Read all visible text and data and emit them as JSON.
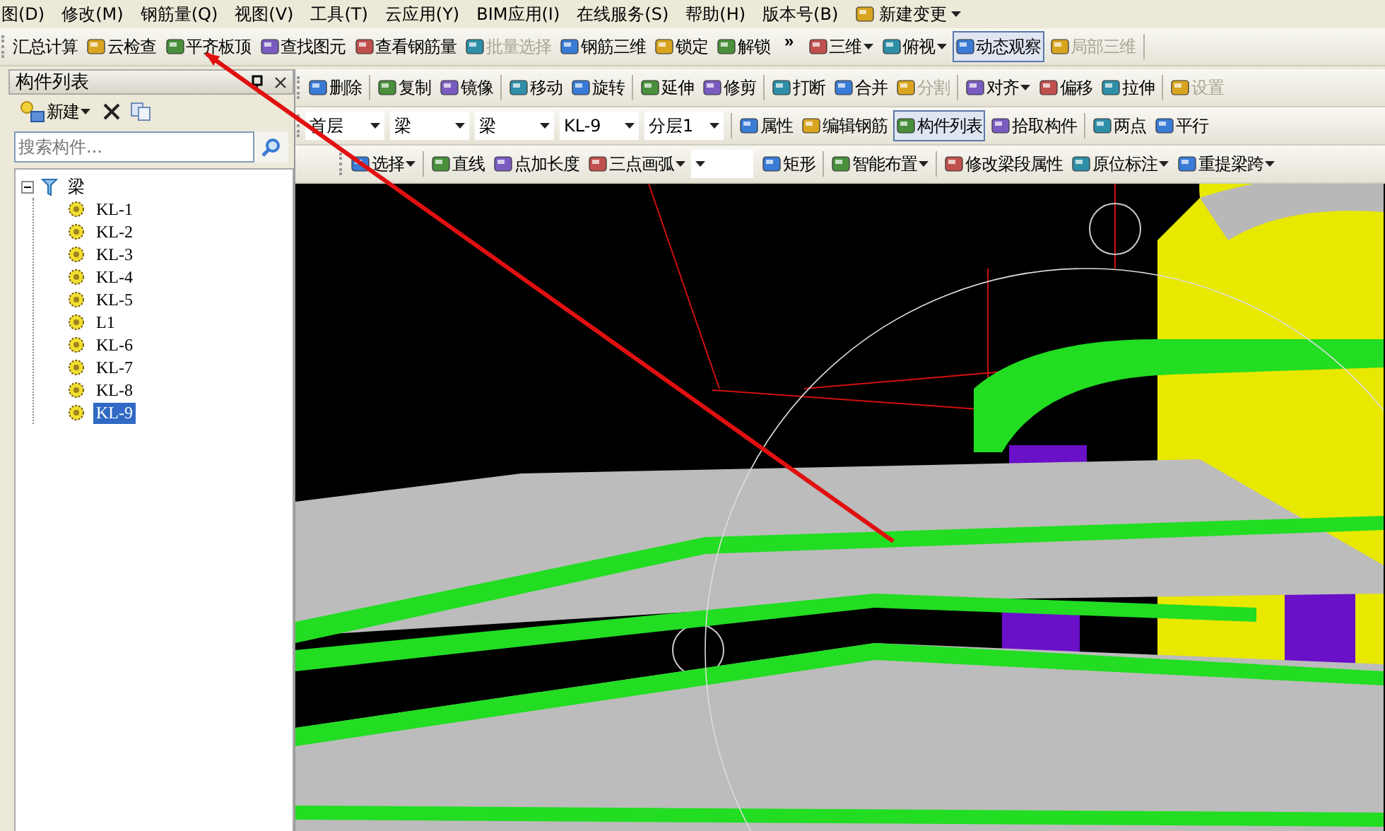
{
  "menu": [
    {
      "label": "图(D)",
      "kind": "text"
    },
    {
      "label": "修改(M)",
      "kind": "text"
    },
    {
      "label": "钢筋量(Q)",
      "kind": "text"
    },
    {
      "label": "视图(V)",
      "kind": "text"
    },
    {
      "label": "工具(T)",
      "kind": "text"
    },
    {
      "label": "云应用(Y)",
      "kind": "text"
    },
    {
      "label": "BIM应用(I)",
      "kind": "text"
    },
    {
      "label": "在线服务(S)",
      "kind": "text"
    },
    {
      "label": "帮助(H)",
      "kind": "text"
    },
    {
      "label": "版本号(B)",
      "kind": "text"
    },
    {
      "label": "新建变更",
      "kind": "menu-button"
    }
  ],
  "main_toolbar": [
    {
      "label": "汇总计算",
      "kind": "text",
      "disabled": false,
      "pressed": false
    },
    {
      "label": "云检查",
      "kind": "button",
      "disabled": false,
      "pressed": false
    },
    {
      "label": "平齐板顶",
      "kind": "button",
      "disabled": false,
      "pressed": false
    },
    {
      "label": "查找图元",
      "kind": "button",
      "disabled": false,
      "pressed": false
    },
    {
      "label": "查看钢筋量",
      "kind": "button",
      "disabled": false,
      "pressed": false
    },
    {
      "label": "批量选择",
      "kind": "button",
      "disabled": true,
      "pressed": false
    },
    {
      "label": "钢筋三维",
      "kind": "button",
      "disabled": false,
      "pressed": false
    },
    {
      "label": "锁定",
      "kind": "button",
      "disabled": false,
      "pressed": false
    },
    {
      "label": "解锁",
      "kind": "button",
      "disabled": false,
      "pressed": false
    },
    {
      "label": "»",
      "kind": "overflow"
    },
    {
      "label": "三维",
      "kind": "menu-button",
      "disabled": false,
      "pressed": false
    },
    {
      "label": "俯视",
      "kind": "menu-button",
      "disabled": false,
      "pressed": false
    },
    {
      "label": "动态观察",
      "kind": "button",
      "disabled": false,
      "pressed": true
    },
    {
      "label": "局部三维",
      "kind": "button",
      "disabled": true,
      "pressed": false
    },
    {
      "kind": "separator"
    }
  ],
  "component_panel": {
    "title": "构件列表",
    "toolbar": [
      {
        "label": "新建",
        "kind": "menu-button"
      },
      {
        "kind": "delete"
      },
      {
        "kind": "copy"
      }
    ],
    "search": {
      "placeholder": "搜索构件..."
    },
    "tree": [
      {
        "label": "梁",
        "expanded": true,
        "selected": false,
        "children": [
          {
            "label": "KL-1",
            "selected": false
          },
          {
            "label": "KL-2",
            "selected": false
          },
          {
            "label": "KL-3",
            "selected": false
          },
          {
            "label": "KL-4",
            "selected": false
          },
          {
            "label": "KL-5",
            "selected": false
          },
          {
            "label": "L1",
            "selected": false
          },
          {
            "label": "KL-6",
            "selected": false
          },
          {
            "label": "KL-7",
            "selected": false
          },
          {
            "label": "KL-8",
            "selected": false
          },
          {
            "label": "KL-9",
            "selected": true
          }
        ]
      }
    ]
  },
  "edit_toolbar": [
    {
      "label": "删除",
      "kind": "button",
      "disabled": false,
      "pressed": false
    },
    {
      "kind": "separator"
    },
    {
      "label": "复制",
      "kind": "button",
      "disabled": false,
      "pressed": false
    },
    {
      "label": "镜像",
      "kind": "button",
      "disabled": false,
      "pressed": false
    },
    {
      "kind": "separator"
    },
    {
      "label": "移动",
      "kind": "button",
      "disabled": false,
      "pressed": false
    },
    {
      "label": "旋转",
      "kind": "button",
      "disabled": false,
      "pressed": false
    },
    {
      "kind": "separator"
    },
    {
      "label": "延伸",
      "kind": "button",
      "disabled": false,
      "pressed": false
    },
    {
      "label": "修剪",
      "kind": "button",
      "disabled": false,
      "pressed": false
    },
    {
      "kind": "separator"
    },
    {
      "label": "打断",
      "kind": "button",
      "disabled": false,
      "pressed": false
    },
    {
      "label": "合并",
      "kind": "button",
      "disabled": false,
      "pressed": false
    },
    {
      "label": "分割",
      "kind": "button",
      "disabled": true,
      "pressed": false
    },
    {
      "kind": "separator"
    },
    {
      "label": "对齐",
      "kind": "menu-button",
      "disabled": false,
      "pressed": false
    },
    {
      "label": "偏移",
      "kind": "button",
      "disabled": false,
      "pressed": false
    },
    {
      "label": "拉伸",
      "kind": "button",
      "disabled": false,
      "pressed": false
    },
    {
      "kind": "separator"
    },
    {
      "label": "设置",
      "kind": "button",
      "disabled": true,
      "pressed": false
    }
  ],
  "property_toolbar": [
    {
      "label": "首层",
      "kind": "select"
    },
    {
      "label": "梁",
      "kind": "select"
    },
    {
      "label": "梁",
      "kind": "select"
    },
    {
      "label": "KL-9",
      "kind": "select"
    },
    {
      "label": "分层1",
      "kind": "select"
    },
    {
      "kind": "separator"
    },
    {
      "label": "属性",
      "kind": "button",
      "disabled": false,
      "pressed": false
    },
    {
      "label": "编辑钢筋",
      "kind": "button",
      "disabled": false,
      "pressed": false
    },
    {
      "label": "构件列表",
      "kind": "button",
      "disabled": false,
      "pressed": true
    },
    {
      "label": "拾取构件",
      "kind": "button",
      "disabled": false,
      "pressed": false
    },
    {
      "kind": "separator"
    },
    {
      "label": "两点",
      "kind": "button",
      "disabled": false,
      "pressed": false
    },
    {
      "label": "平行",
      "kind": "button",
      "disabled": false,
      "pressed": false
    }
  ],
  "draw_toolbar": [
    {
      "label": "选择",
      "kind": "menu-button",
      "disabled": false,
      "pressed": false
    },
    {
      "kind": "separator"
    },
    {
      "label": "直线",
      "kind": "button",
      "disabled": false,
      "pressed": false
    },
    {
      "label": "点加长度",
      "kind": "button",
      "disabled": false,
      "pressed": false
    },
    {
      "label": "三点画弧",
      "kind": "menu-button",
      "disabled": false,
      "pressed": false
    },
    {
      "kind": "select"
    },
    {
      "label": "矩形",
      "kind": "button",
      "disabled": false,
      "pressed": false
    },
    {
      "kind": "separator"
    },
    {
      "label": "智能布置",
      "kind": "menu-button",
      "disabled": false,
      "pressed": false
    },
    {
      "kind": "separator"
    },
    {
      "label": "修改梁段属性",
      "kind": "button",
      "disabled": false,
      "pressed": false
    },
    {
      "label": "原位标注",
      "kind": "menu-button",
      "disabled": false,
      "pressed": false
    },
    {
      "label": "重提梁跨",
      "kind": "menu-button",
      "disabled": false,
      "pressed": false
    }
  ]
}
